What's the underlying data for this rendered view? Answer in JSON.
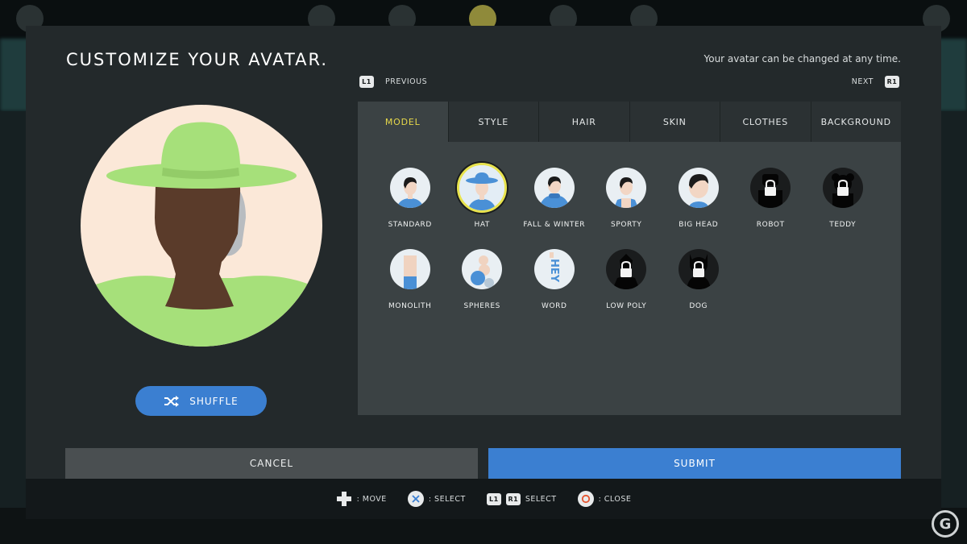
{
  "dialog": {
    "title": "CUSTOMIZE YOUR AVATAR.",
    "hint": "Your avatar can be changed at any time."
  },
  "nav": {
    "prev_button": "L1",
    "prev_label": "PREVIOUS",
    "next_label": "NEXT",
    "next_button": "R1"
  },
  "tabs": [
    {
      "label": "MODEL",
      "active": true
    },
    {
      "label": "STYLE",
      "active": false
    },
    {
      "label": "HAIR",
      "active": false
    },
    {
      "label": "SKIN",
      "active": false
    },
    {
      "label": "CLOTHES",
      "active": false
    },
    {
      "label": "BACKGROUND",
      "active": false
    }
  ],
  "models": {
    "row1": [
      {
        "label": "STANDARD",
        "icon": "standard-avatar-icon",
        "locked": false,
        "selected": false
      },
      {
        "label": "HAT",
        "icon": "hat-avatar-icon",
        "locked": false,
        "selected": true
      },
      {
        "label": "FALL & WINTER",
        "icon": "fall-winter-avatar-icon",
        "locked": false,
        "selected": false
      },
      {
        "label": "SPORTY",
        "icon": "sporty-avatar-icon",
        "locked": false,
        "selected": false
      },
      {
        "label": "BIG HEAD",
        "icon": "big-head-avatar-icon",
        "locked": false,
        "selected": false
      },
      {
        "label": "ROBOT",
        "icon": "lock-icon",
        "locked": true,
        "selected": false
      },
      {
        "label": "TEDDY",
        "icon": "lock-icon",
        "locked": true,
        "selected": false
      }
    ],
    "row2": [
      {
        "label": "MONOLITH",
        "icon": "monolith-avatar-icon",
        "locked": false,
        "selected": false
      },
      {
        "label": "SPHERES",
        "icon": "spheres-avatar-icon",
        "locked": false,
        "selected": false
      },
      {
        "label": "WORD",
        "icon": "word-avatar-icon",
        "word_text": "HEY",
        "locked": false,
        "selected": false
      },
      {
        "label": "LOW POLY",
        "icon": "lock-icon",
        "locked": true,
        "selected": false
      },
      {
        "label": "DOG",
        "icon": "lock-icon",
        "locked": true,
        "selected": false
      }
    ]
  },
  "shuffle": {
    "label": "SHUFFLE",
    "icon": "shuffle-icon"
  },
  "actions": {
    "cancel": "CANCEL",
    "submit": "SUBMIT"
  },
  "controls": {
    "move": ": MOVE",
    "select_x": ": SELECT",
    "l1": "L1",
    "r1": "R1",
    "select_lr": "SELECT",
    "close": ": CLOSE"
  },
  "colors": {
    "accent_blue": "#3b7fd1",
    "active_tab": "#e6d84a",
    "selected_ring": "#e8e34e",
    "avatar_bg": "#fbe8d8",
    "hat_green": "#a6e07a"
  }
}
